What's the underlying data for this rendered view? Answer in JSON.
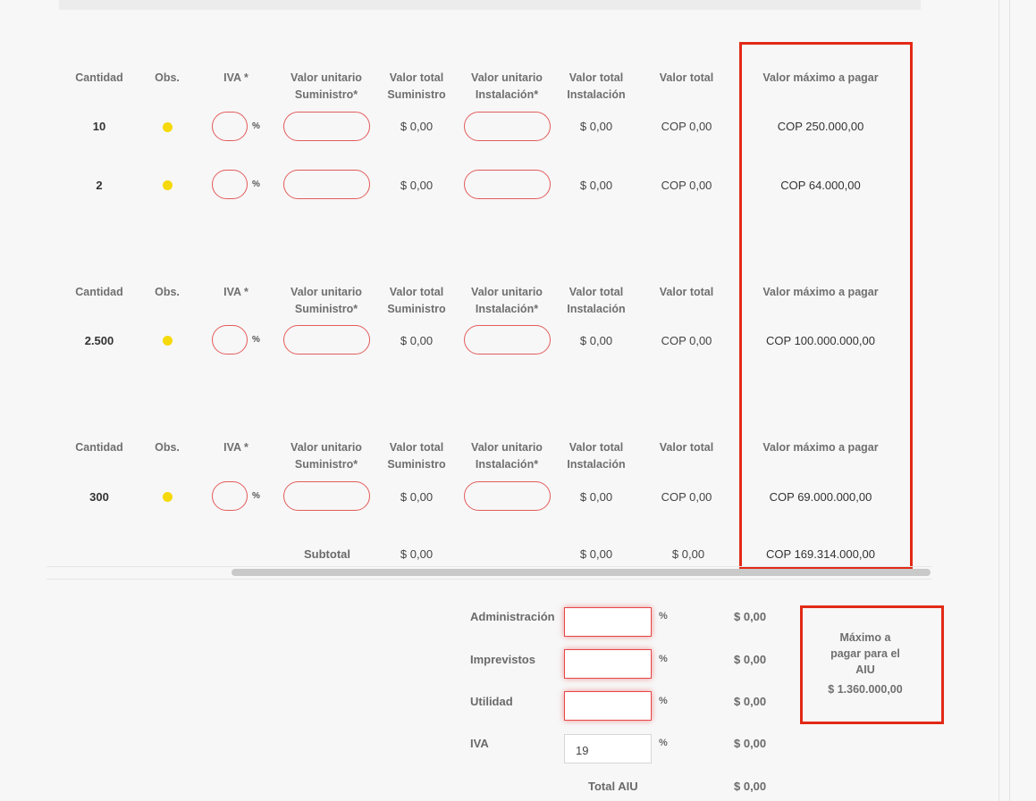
{
  "headers": {
    "cantidad": "Cantidad",
    "obs": "Obs.",
    "iva": "IVA *",
    "vu_sum_1": "Valor unitario",
    "vu_sum_2": "Suministro*",
    "vt_sum_1": "Valor total",
    "vt_sum_2": "Suministro",
    "vu_ins_1": "Valor unitario",
    "vu_ins_2": "Instalación*",
    "vt_ins_1": "Valor total",
    "vt_ins_2": "Instalación",
    "vt": "Valor total",
    "max": "Valor máximo a pagar"
  },
  "percent_sign": "%",
  "rows": [
    {
      "qty": "10",
      "total_sum": "$ 0,00",
      "total_ins": "$ 0,00",
      "total": "COP 0,00",
      "max": "COP 250.000,00"
    },
    {
      "qty": "2",
      "total_sum": "$ 0,00",
      "total_ins": "$ 0,00",
      "total": "COP 0,00",
      "max": "COP 64.000,00"
    },
    {
      "qty": "2.500",
      "total_sum": "$ 0,00",
      "total_ins": "$ 0,00",
      "total": "COP 0,00",
      "max": "COP 100.000.000,00"
    },
    {
      "qty": "300",
      "total_sum": "$ 0,00",
      "total_ins": "$ 0,00",
      "total": "COP 0,00",
      "max": "COP 69.000.000,00"
    }
  ],
  "subtotal": {
    "label": "Subtotal",
    "sum": "$ 0,00",
    "ins": "$ 0,00",
    "total": "$ 0,00",
    "max": "COP 169.314.000,00"
  },
  "aiu": {
    "admin_label": "Administración",
    "admin_value": "$ 0,00",
    "imprevistos_label": "Imprevistos",
    "imprevistos_value": "$ 0,00",
    "utilidad_label": "Utilidad",
    "utilidad_value": "$ 0,00",
    "iva_label": "IVA",
    "iva_input": "19",
    "iva_value": "$ 0,00",
    "total_label": "Total AIU",
    "total_value": "$ 0,00",
    "max_line1": "Máximo a",
    "max_line2": "pagar para el",
    "max_line3": "AIU",
    "max_value": "$ 1.360.000,00"
  },
  "colors": {
    "highlight_box": "#e22a17",
    "invalid_border": "#e45b5b",
    "status_dot": "#f5d90a"
  }
}
